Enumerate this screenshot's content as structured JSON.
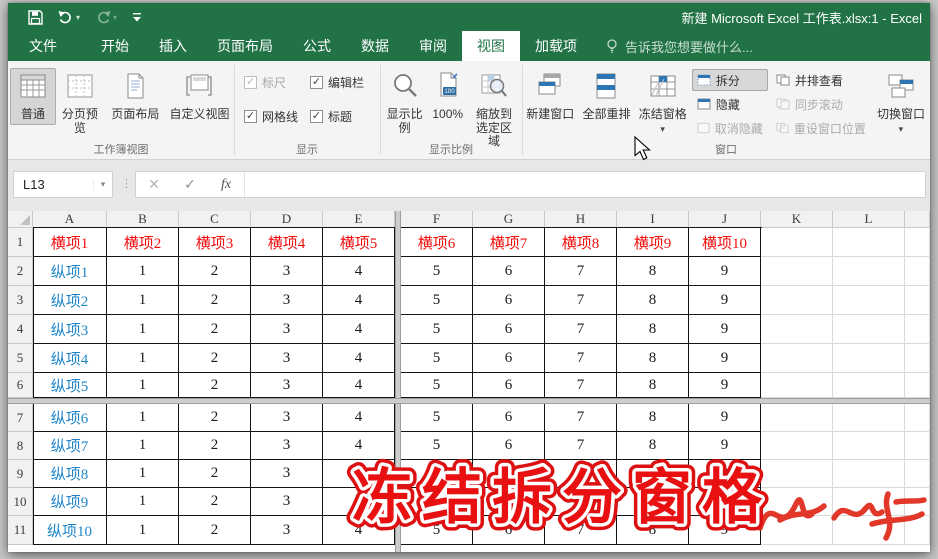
{
  "title_bar": {
    "title": "新建 Microsoft Excel 工作表.xlsx:1 - Excel"
  },
  "tabs": {
    "file": "文件",
    "items": [
      "开始",
      "插入",
      "页面布局",
      "公式",
      "数据",
      "审阅",
      "视图",
      "加载项"
    ],
    "active": "视图",
    "tell_me": "告诉我您想要做什么..."
  },
  "ribbon": {
    "view_group": {
      "label": "工作簿视图",
      "normal": "普通",
      "page_break": "分页预览",
      "page_layout": "页面布局",
      "custom_views": "自定义视图"
    },
    "show_group": {
      "label": "显示",
      "ruler": "标尺",
      "formula_bar": "编辑栏",
      "gridlines": "网格线",
      "headings": "标题"
    },
    "zoom_group": {
      "label": "显示比例",
      "zoom": "显示比例",
      "hundred": "100%",
      "zoom_selection": "缩放到选定区域"
    },
    "window_group": {
      "label": "窗口",
      "new_window": "新建窗口",
      "arrange_all": "全部重排",
      "freeze_panes": "冻结窗格",
      "split": "拆分",
      "hide": "隐藏",
      "unhide": "取消隐藏",
      "side_by_side": "并排查看",
      "sync_scroll": "同步滚动",
      "reset_position": "重设窗口位置",
      "switch_windows": "切换窗口"
    }
  },
  "formula_bar": {
    "name_box": "L13",
    "formula": ""
  },
  "sheet": {
    "column_letters": [
      "A",
      "B",
      "C",
      "D",
      "E",
      "F",
      "G",
      "H",
      "I",
      "J",
      "K",
      "L"
    ],
    "row_numbers": [
      "1",
      "2",
      "3",
      "4",
      "5",
      "6",
      "7",
      "8",
      "9",
      "10",
      "11"
    ],
    "top_row": [
      "横项1",
      "横项2",
      "横项3",
      "横项4",
      "横项5",
      "横项6",
      "横项7",
      "横项8",
      "横项9",
      "横项10"
    ],
    "left_labels": [
      "纵项1",
      "纵项2",
      "纵项3",
      "纵项4",
      "纵项5",
      "纵项6",
      "纵项7",
      "纵项8",
      "纵项9",
      "纵项10"
    ],
    "values_each_row": [
      1,
      2,
      3,
      4,
      5,
      6,
      7,
      8,
      9
    ]
  },
  "overlay": {
    "caption": "冻结拆分窗格"
  },
  "colors": {
    "excel_green": "#217346",
    "header_red": "#F20D0D",
    "label_blue": "#1E86C8",
    "caption_red": "#E81010"
  }
}
